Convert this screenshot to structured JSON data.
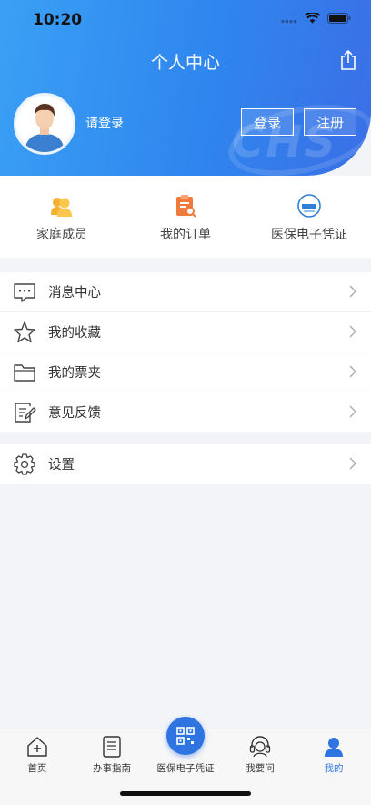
{
  "status_bar": {
    "time": "10:20"
  },
  "header": {
    "title": "个人中心",
    "login_hint": "请登录",
    "login_button": "登录",
    "register_button": "注册",
    "watermark": "CHS"
  },
  "quick_actions": [
    {
      "label": "家庭成员",
      "icon": "family-members-icon",
      "color": "#f5b12f"
    },
    {
      "label": "我的订单",
      "icon": "orders-icon",
      "color": "#f07a3c"
    },
    {
      "label": "医保电子凭证",
      "icon": "chs-logo-icon",
      "color": "#2f7fd6"
    }
  ],
  "menu_group_1": [
    {
      "label": "消息中心",
      "icon": "message-icon"
    },
    {
      "label": "我的收藏",
      "icon": "star-icon"
    },
    {
      "label": "我的票夹",
      "icon": "folder-icon"
    },
    {
      "label": "意见反馈",
      "icon": "feedback-icon"
    }
  ],
  "menu_group_2": [
    {
      "label": "设置",
      "icon": "gear-icon"
    }
  ],
  "tabbar": {
    "items": [
      {
        "label": "首页",
        "icon": "home-icon"
      },
      {
        "label": "办事指南",
        "icon": "guide-icon"
      },
      {
        "label": "医保电子凭证",
        "icon": "qr-code-icon"
      },
      {
        "label": "我要问",
        "icon": "customer-service-icon"
      },
      {
        "label": "我的",
        "icon": "profile-icon"
      }
    ],
    "active_index": 4,
    "active_color": "#2f75e2"
  },
  "colors": {
    "header_start": "#3aa0f5",
    "header_end": "#3b6fe6"
  }
}
